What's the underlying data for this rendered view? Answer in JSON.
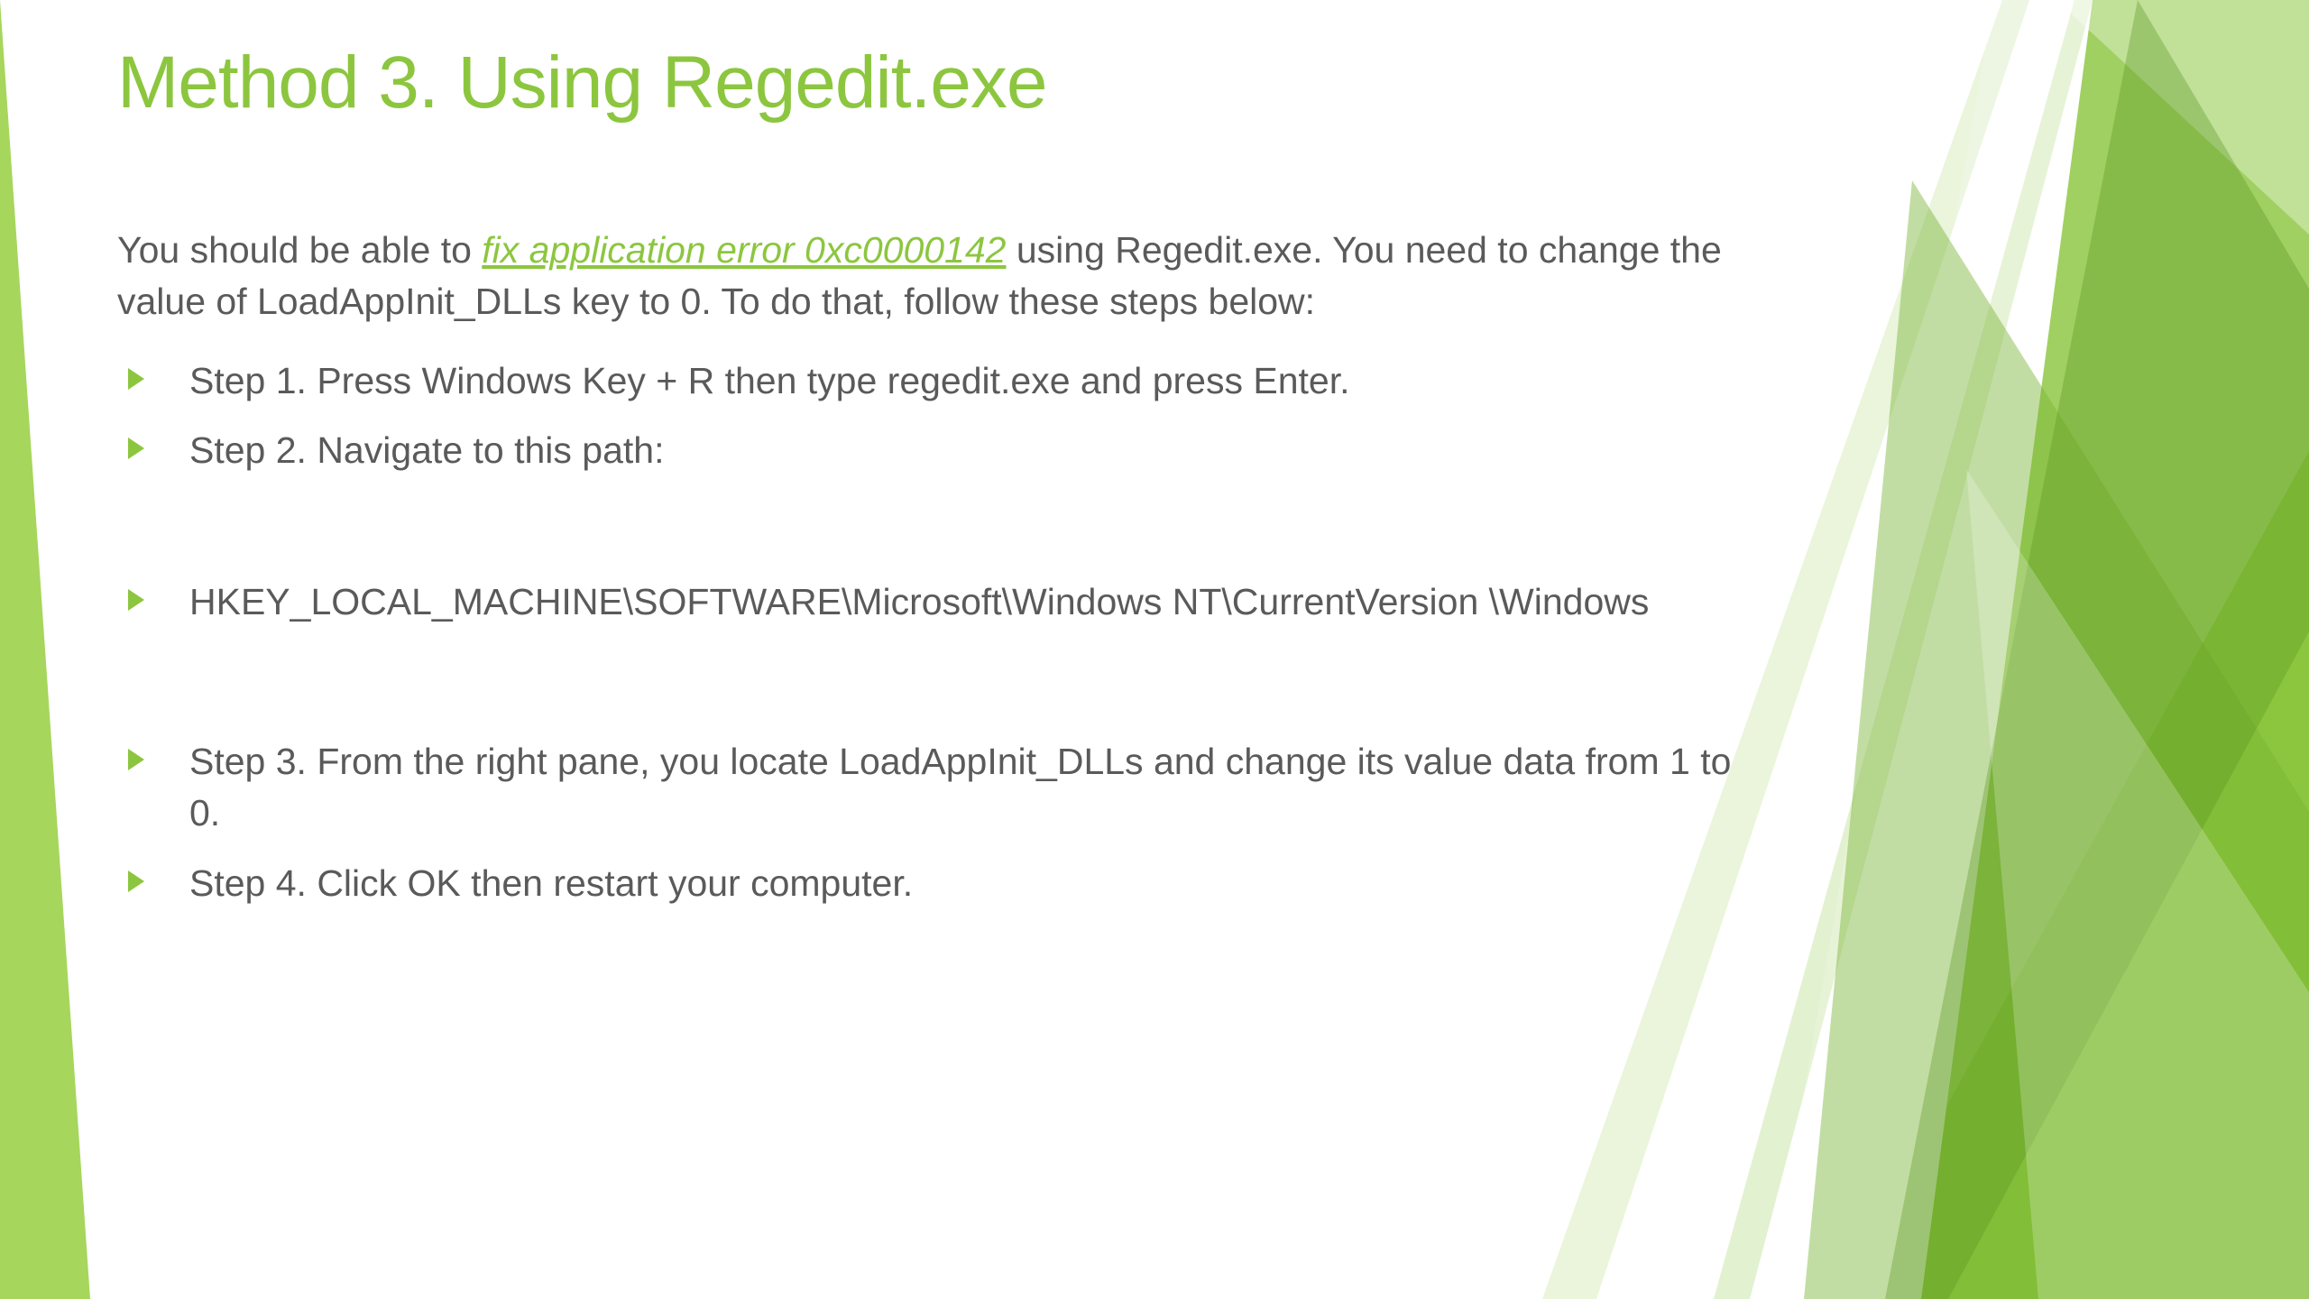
{
  "title": "Method 3. Using Regedit.exe",
  "intro": {
    "pre": "You should be able to ",
    "link_text": "fix application error 0xc0000142",
    "post": " using Regedit.exe. You need to change the value of LoadAppInit_DLLs key to 0. To do that, follow these steps below:"
  },
  "bullets": {
    "step1": "Step 1. Press Windows Key + R then type regedit.exe and press Enter.",
    "step2": "Step 2. Navigate to this path:",
    "path": "HKEY_LOCAL_MACHINE\\SOFTWARE\\Microsoft\\Windows NT\\CurrentVersion \\Windows",
    "step3": "Step 3. From the right pane, you locate LoadAppInit_DLLs and change its value data from 1 to 0.",
    "step4": "Step 4. Click OK then restart your computer."
  }
}
